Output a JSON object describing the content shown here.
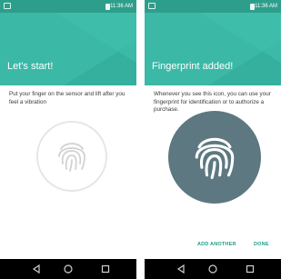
{
  "status_bar": {
    "time": "11:36 AM"
  },
  "screen_start": {
    "title": "Let's start!",
    "description": "Put your finger on the sensor and lift after you feel a vibration"
  },
  "screen_added": {
    "title": "Fingerprint added!",
    "description": "Whenever you see this icon, you can use your fingerprint for identification or to authorize a purchase.",
    "add_another_label": "ADD ANOTHER",
    "done_label": "DONE"
  },
  "colors": {
    "header_teal": "#35b09e",
    "status_teal": "#2e9e8c",
    "accent": "#1d9d8b",
    "fingerprint_disc": "#5d7880"
  },
  "icons": [
    "fingerprint-icon",
    "back-icon",
    "home-icon",
    "recents-icon"
  ]
}
